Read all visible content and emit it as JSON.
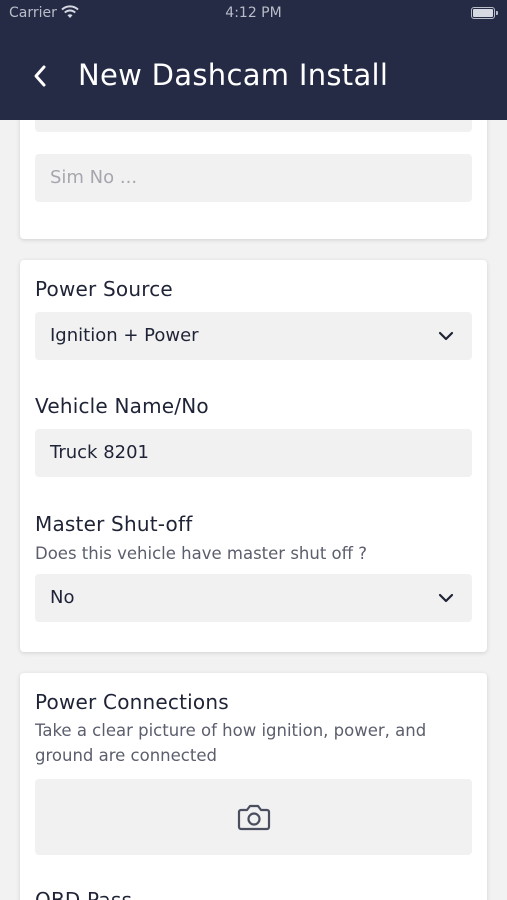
{
  "status_bar": {
    "carrier": "Carrier",
    "time": "4:12 PM"
  },
  "nav": {
    "title": "New Dashcam Install"
  },
  "sim_card": {
    "sim_placeholder": "Sim No ..."
  },
  "power_card": {
    "power_source_label": "Power Source",
    "power_source_value": "Ignition + Power",
    "vehicle_label": "Vehicle Name/No",
    "vehicle_value": "Truck 8201",
    "master_label": "Master Shut-off",
    "master_help": "Does this vehicle have master shut off ?",
    "master_value": "No"
  },
  "connections_card": {
    "label": "Power Connections",
    "help": "Take a clear picture of how ignition, power, and ground are connected",
    "next_label": "OBD Pass..."
  },
  "icons": [
    "wifi-icon",
    "battery-icon",
    "back-chevron-icon",
    "chevron-down-icon",
    "camera-icon"
  ],
  "colors": {
    "header": "#262b45",
    "field": "#f1f1f2",
    "background": "#f2f2f3"
  }
}
